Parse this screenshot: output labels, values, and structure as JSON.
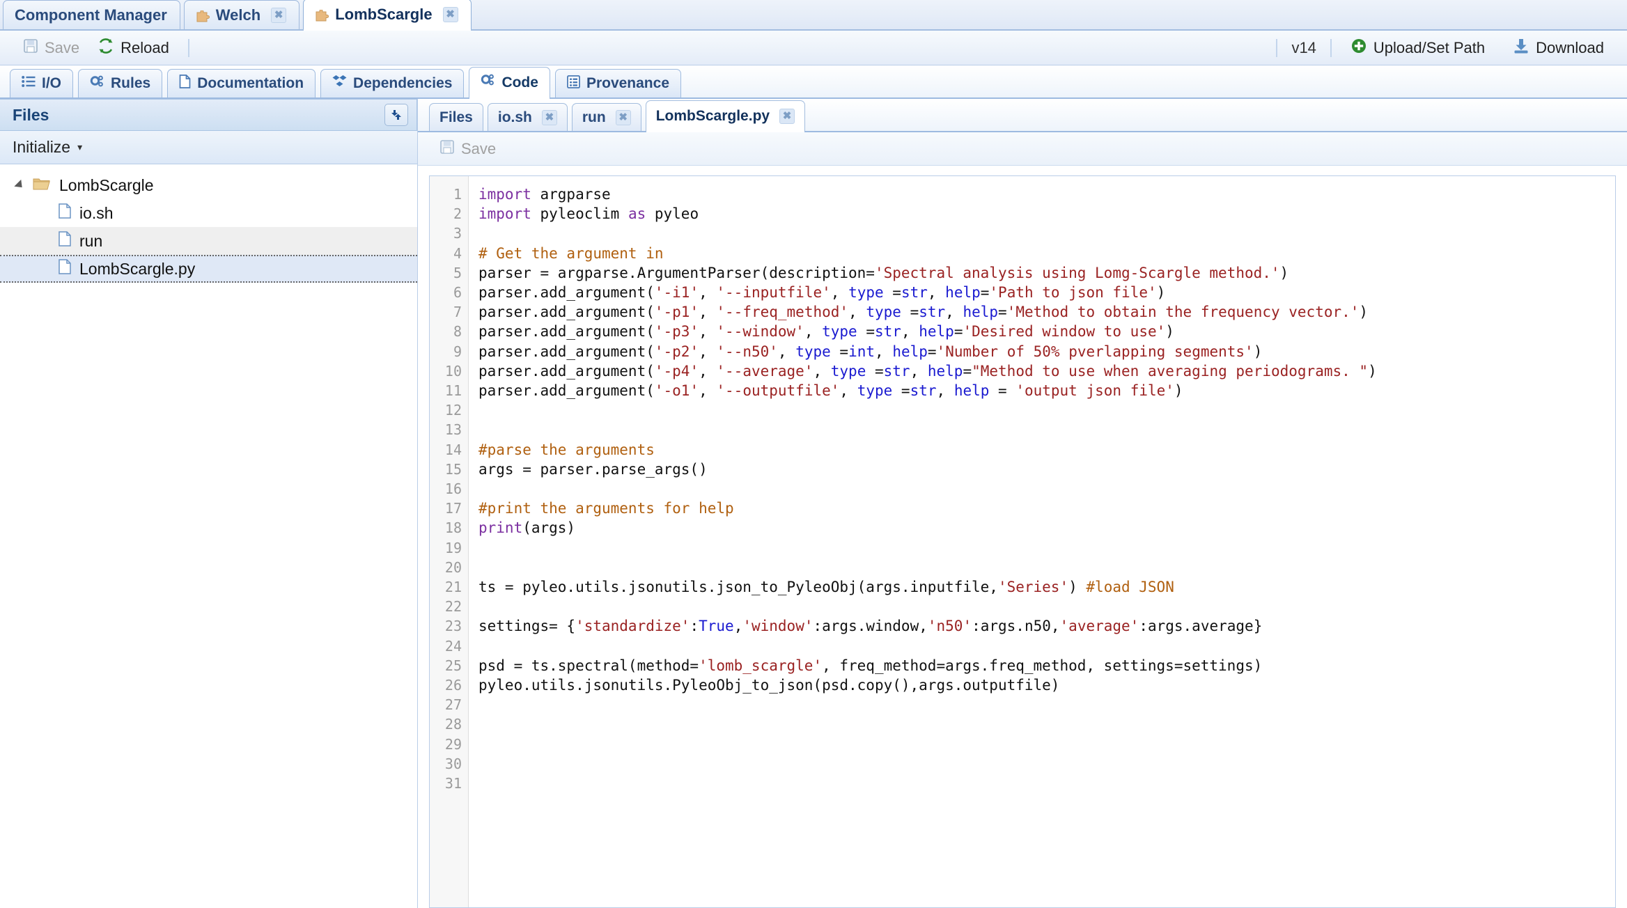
{
  "window": {
    "component_tabs": [
      {
        "label": "Component Manager",
        "icon": null,
        "closable": false,
        "active": false
      },
      {
        "label": "Welch",
        "icon": "puzzle-icon",
        "closable": true,
        "active": false
      },
      {
        "label": "LombScargle",
        "icon": "puzzle-icon",
        "closable": true,
        "active": true
      }
    ]
  },
  "toolbar": {
    "save_label": "Save",
    "save_icon": "floppy-disk-icon",
    "reload_label": "Reload",
    "reload_icon": "refresh-icon",
    "version": "v14",
    "upload_label": "Upload/Set Path",
    "upload_icon": "plus-circle-icon",
    "download_label": "Download",
    "download_icon": "download-icon"
  },
  "section_tabs": [
    {
      "label": "I/O",
      "icon": "list-icon",
      "active": false
    },
    {
      "label": "Rules",
      "icon": "gears-icon",
      "active": false
    },
    {
      "label": "Documentation",
      "icon": "document-icon",
      "active": false
    },
    {
      "label": "Dependencies",
      "icon": "diamonds-icon",
      "active": false
    },
    {
      "label": "Code",
      "icon": "gears-icon",
      "active": true
    },
    {
      "label": "Provenance",
      "icon": "listdoc-icon",
      "active": false
    }
  ],
  "files_panel": {
    "title": "Files",
    "refresh_icon": "refresh-arrows-icon",
    "initialize_label": "Initialize",
    "initialize_caret": "▾",
    "tree": [
      {
        "label": "LombScargle",
        "type": "folder",
        "icon": "folder-open-icon",
        "depth": 0,
        "expanded": true,
        "selected": false,
        "alt": false
      },
      {
        "label": "io.sh",
        "type": "file",
        "icon": "file-icon",
        "depth": 1,
        "selected": false,
        "alt": false
      },
      {
        "label": "run",
        "type": "file",
        "icon": "file-icon",
        "depth": 1,
        "selected": false,
        "alt": true
      },
      {
        "label": "LombScargle.py",
        "type": "file",
        "icon": "file-icon",
        "depth": 1,
        "selected": true,
        "alt": false
      }
    ]
  },
  "editor": {
    "file_tabs": [
      {
        "label": "Files",
        "closable": false,
        "active": false
      },
      {
        "label": "io.sh",
        "closable": true,
        "active": false
      },
      {
        "label": "run",
        "closable": true,
        "active": false
      },
      {
        "label": "LombScargle.py",
        "closable": true,
        "active": true
      }
    ],
    "save_label": "Save",
    "save_icon": "floppy-disk-icon",
    "line_numbers": [
      1,
      2,
      3,
      4,
      5,
      6,
      7,
      8,
      9,
      10,
      11,
      12,
      13,
      14,
      15,
      16,
      17,
      18,
      19,
      20,
      21,
      22,
      23,
      24,
      25,
      26,
      27,
      28,
      29,
      30,
      31
    ],
    "lines": [
      "import argparse",
      "import pyleoclim as pyleo",
      "",
      "# Get the argument in",
      "parser = argparse.ArgumentParser(description='Spectral analysis using Lomg-Scargle method.')",
      "parser.add_argument('-i1', '--inputfile', type =str, help='Path to json file')",
      "parser.add_argument('-p1', '--freq_method', type =str, help='Method to obtain the frequency vector.')",
      "parser.add_argument('-p3', '--window', type =str, help='Desired window to use')",
      "parser.add_argument('-p2', '--n50', type =int, help='Number of 50% pverlapping segments')",
      "parser.add_argument('-p4', '--average', type =str, help=\"Method to use when averaging periodograms. \")",
      "parser.add_argument('-o1', '--outputfile', type =str, help = 'output json file')",
      "",
      "",
      "#parse the arguments",
      "args = parser.parse_args()",
      "",
      "#print the arguments for help",
      "print(args)",
      "",
      "",
      "ts = pyleo.utils.jsonutils.json_to_PyleoObj(args.inputfile,'Series') #load JSON",
      "",
      "settings= {'standardize':True,'window':args.window,'n50':args.n50,'average':args.average}",
      "",
      "psd = ts.spectral(method='lomb_scargle', freq_method=args.freq_method, settings=settings)",
      "pyleo.utils.jsonutils.PyleoObj_to_json(psd.copy(),args.outputfile)",
      "",
      "",
      "",
      "",
      ""
    ]
  },
  "colors": {
    "accent": "#2a4b7c",
    "panel_header": "#1a4477",
    "keyword": "#7b2fa0",
    "comment": "#b06010",
    "string": "#9a2222",
    "builtin": "#1a1ad0",
    "green": "#2e8b30",
    "folder": "#e3c07e"
  }
}
